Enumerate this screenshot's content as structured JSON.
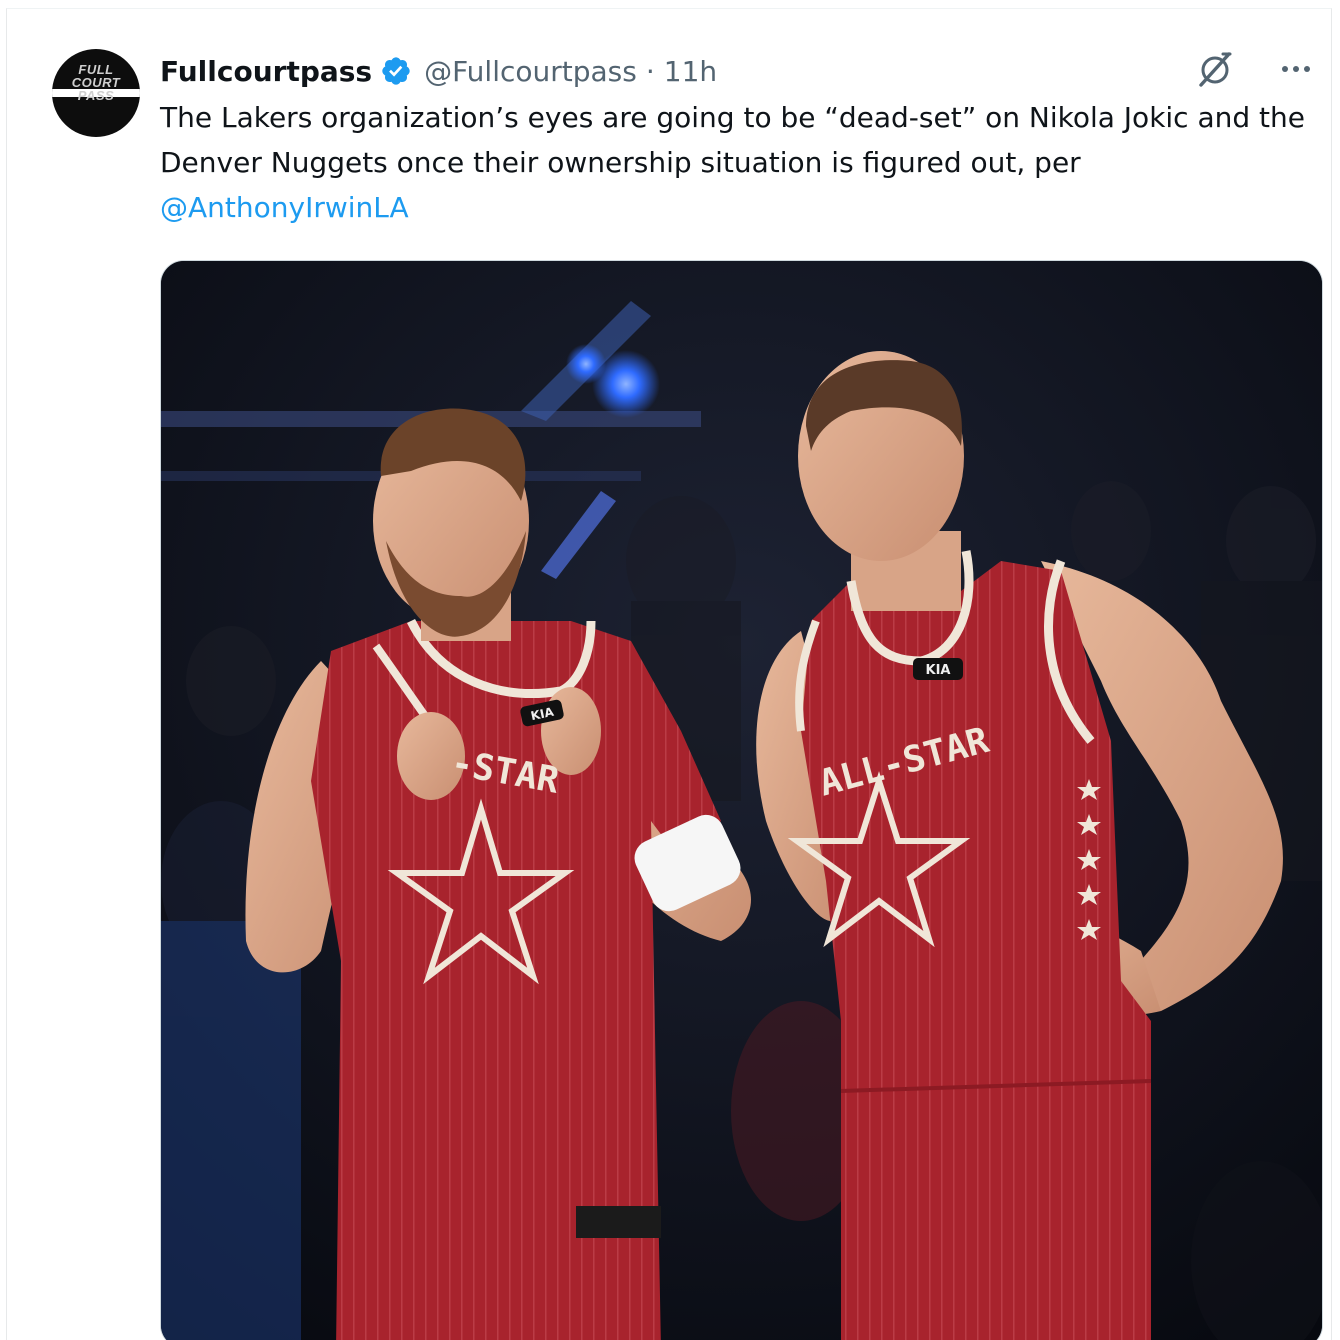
{
  "tweet": {
    "avatar_text": "FULL\nCOURT\nPASS",
    "display_name": "Fullcourtpass",
    "verified": true,
    "handle": "@Fullcourtpass",
    "separator": "·",
    "time": "11h",
    "text_before_mention": "The Lakers organization’s eyes are going to be “dead-set” on Nikola Jokic and the Denver Nuggets once their ownership situation is figured out, per",
    "mention": "@AnthonyIrwinLA",
    "icons": {
      "verified": "verified-badge-icon",
      "grok": "grok-icon",
      "more": "more-options-icon"
    }
  },
  "media": {
    "jersey_text_left": "-STAR",
    "jersey_text_right": "ALL-STAR",
    "sponsor_logo": "KIA",
    "colors": {
      "jersey": "#a8232d",
      "background": "#0c0f1a",
      "accent_blue": "#2f6bff"
    }
  },
  "colors": {
    "text": "#0f1419",
    "secondary": "#536471",
    "link": "#1d9bf0",
    "verified": "#1d9bf0"
  }
}
